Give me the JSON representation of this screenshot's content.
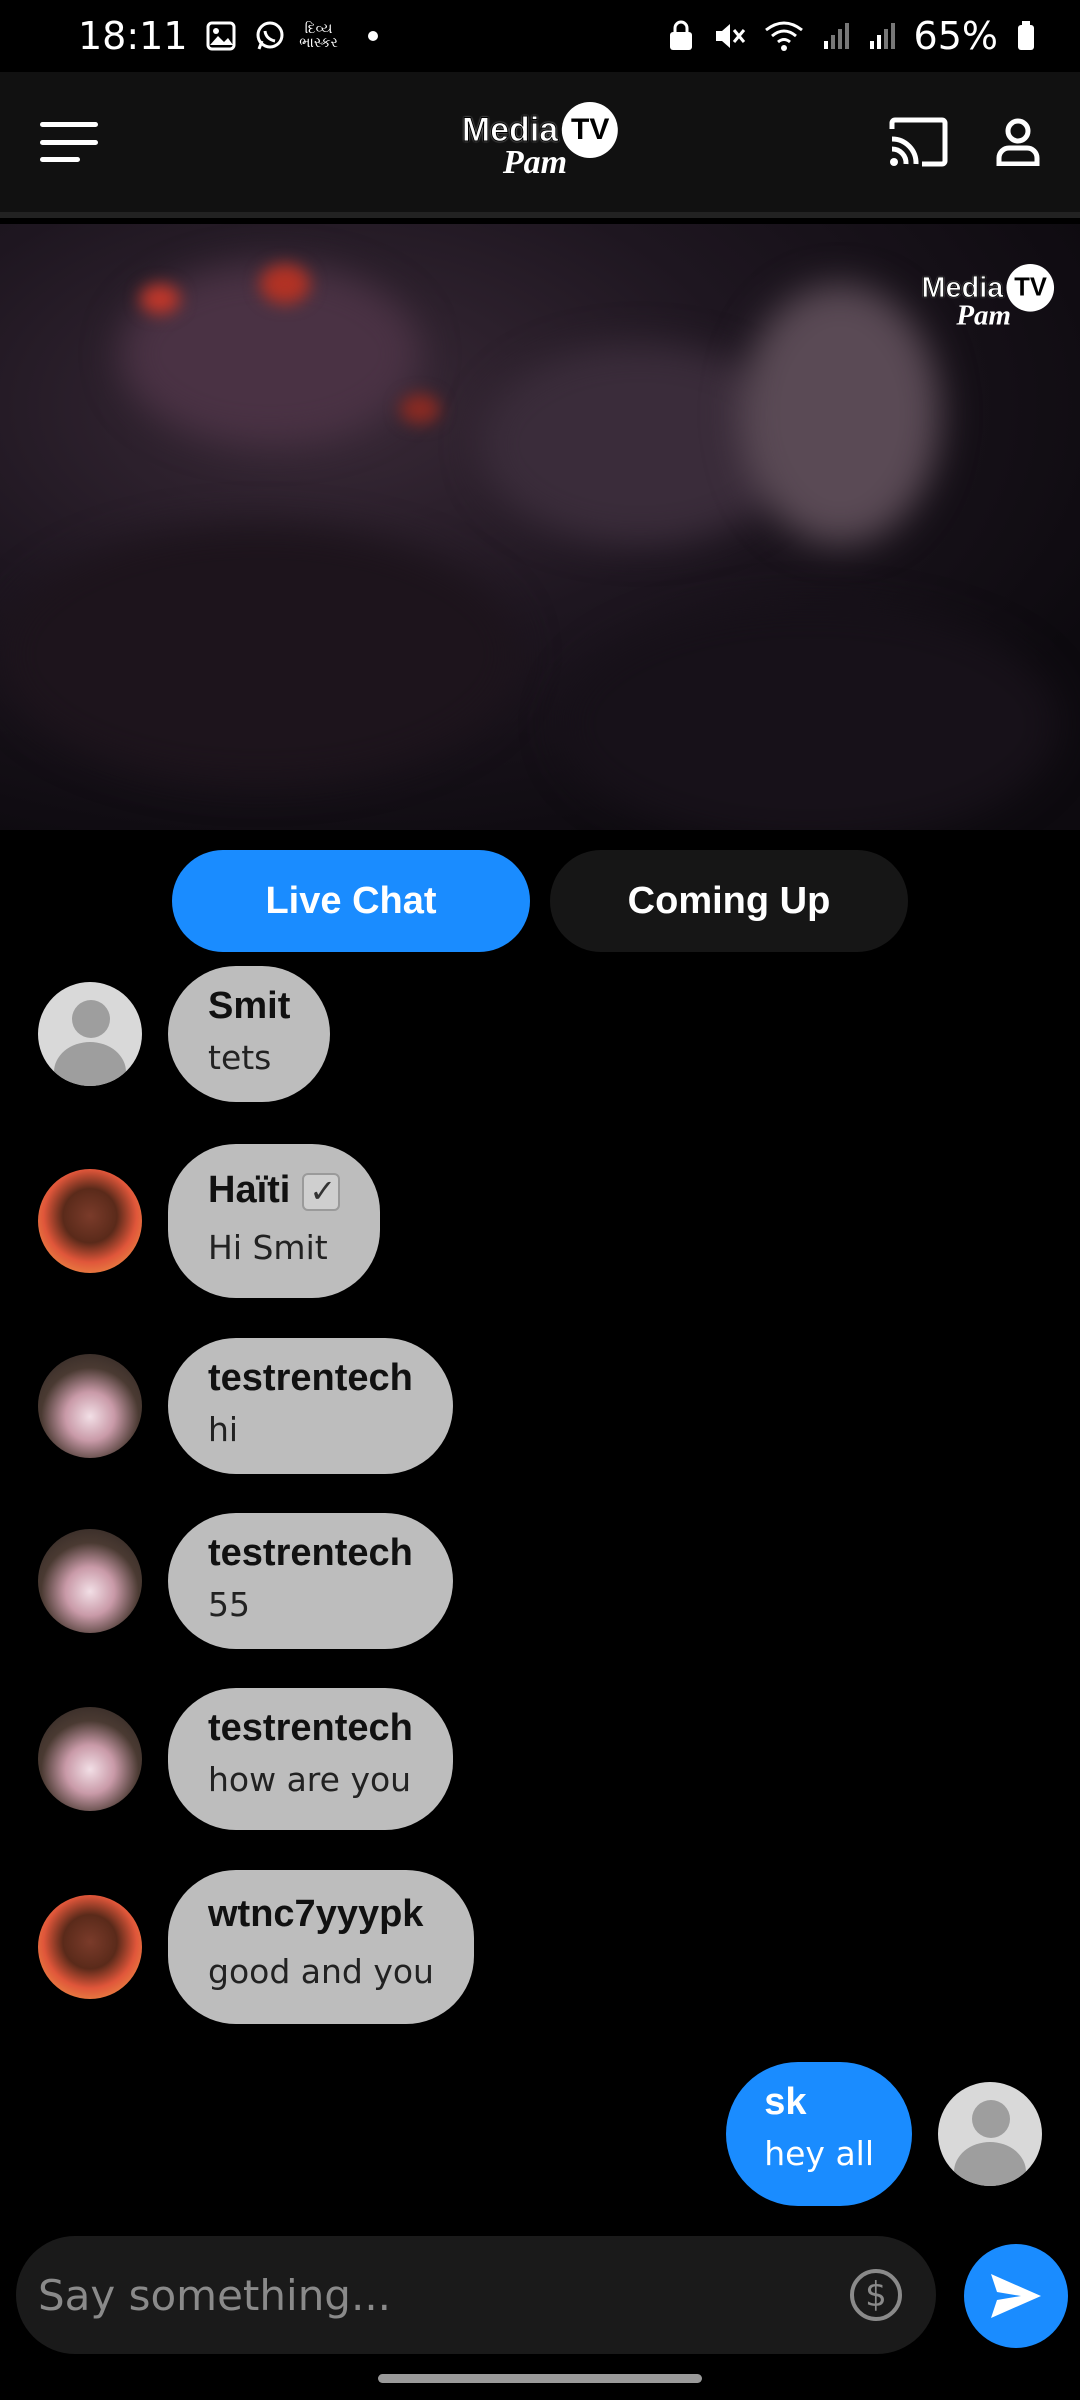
{
  "status_bar": {
    "time": "18:11",
    "notification_text": "દિવ્ય ભાસ્કર",
    "battery": "65%"
  },
  "app_bar": {
    "logo": {
      "top": "Media",
      "badge": "TV",
      "bottom": "Pam"
    }
  },
  "video": {
    "watermark": {
      "top": "Media",
      "badge": "TV",
      "bottom": "Pam"
    }
  },
  "tabs": [
    {
      "label": "Live Chat",
      "active": true
    },
    {
      "label": "Coming Up",
      "active": false
    }
  ],
  "chat": {
    "messages": [
      {
        "name": "Smit",
        "text": "tets",
        "avatar": "default"
      },
      {
        "name": "Haïti",
        "text": "Hi Smit",
        "avatar": "haiti",
        "verified": true
      },
      {
        "name": "testrentech",
        "text": "hi",
        "avatar": "rabbit"
      },
      {
        "name": "testrentech",
        "text": "55",
        "avatar": "rabbit"
      },
      {
        "name": "testrentech",
        "text": "how are you",
        "avatar": "rabbit"
      },
      {
        "name": "wtnc7yyypk",
        "text": "good and you",
        "avatar": "haiti"
      }
    ],
    "own_message": {
      "name": "sk",
      "text": "hey all"
    }
  },
  "input": {
    "placeholder": "Say something...",
    "tip_icon": "$"
  },
  "colors": {
    "accent": "#1a8cff",
    "bubble": "#bdbdbd",
    "background": "#000000"
  }
}
